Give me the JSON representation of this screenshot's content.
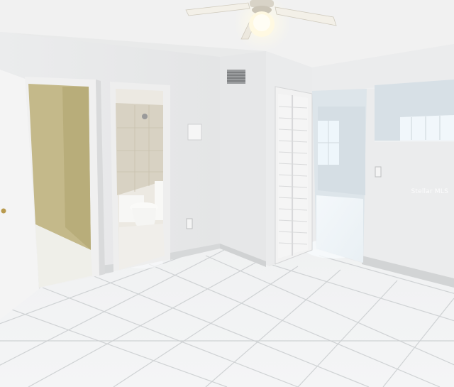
{
  "watermark": {
    "text": "Stellar MLS"
  },
  "colors": {
    "ceiling": "#f1f1f1",
    "wall": "#ecedee",
    "wall_shadow": "#dadcdd",
    "floor_tile": "#f2f3f4",
    "grout": "#cfd2d4",
    "bath_wall": "#c4b98a",
    "closet_interior": "#b8ad7a",
    "door": "#f4f4f4",
    "window_light": "#e8f3fb",
    "light_glow": "#fff7dd"
  }
}
